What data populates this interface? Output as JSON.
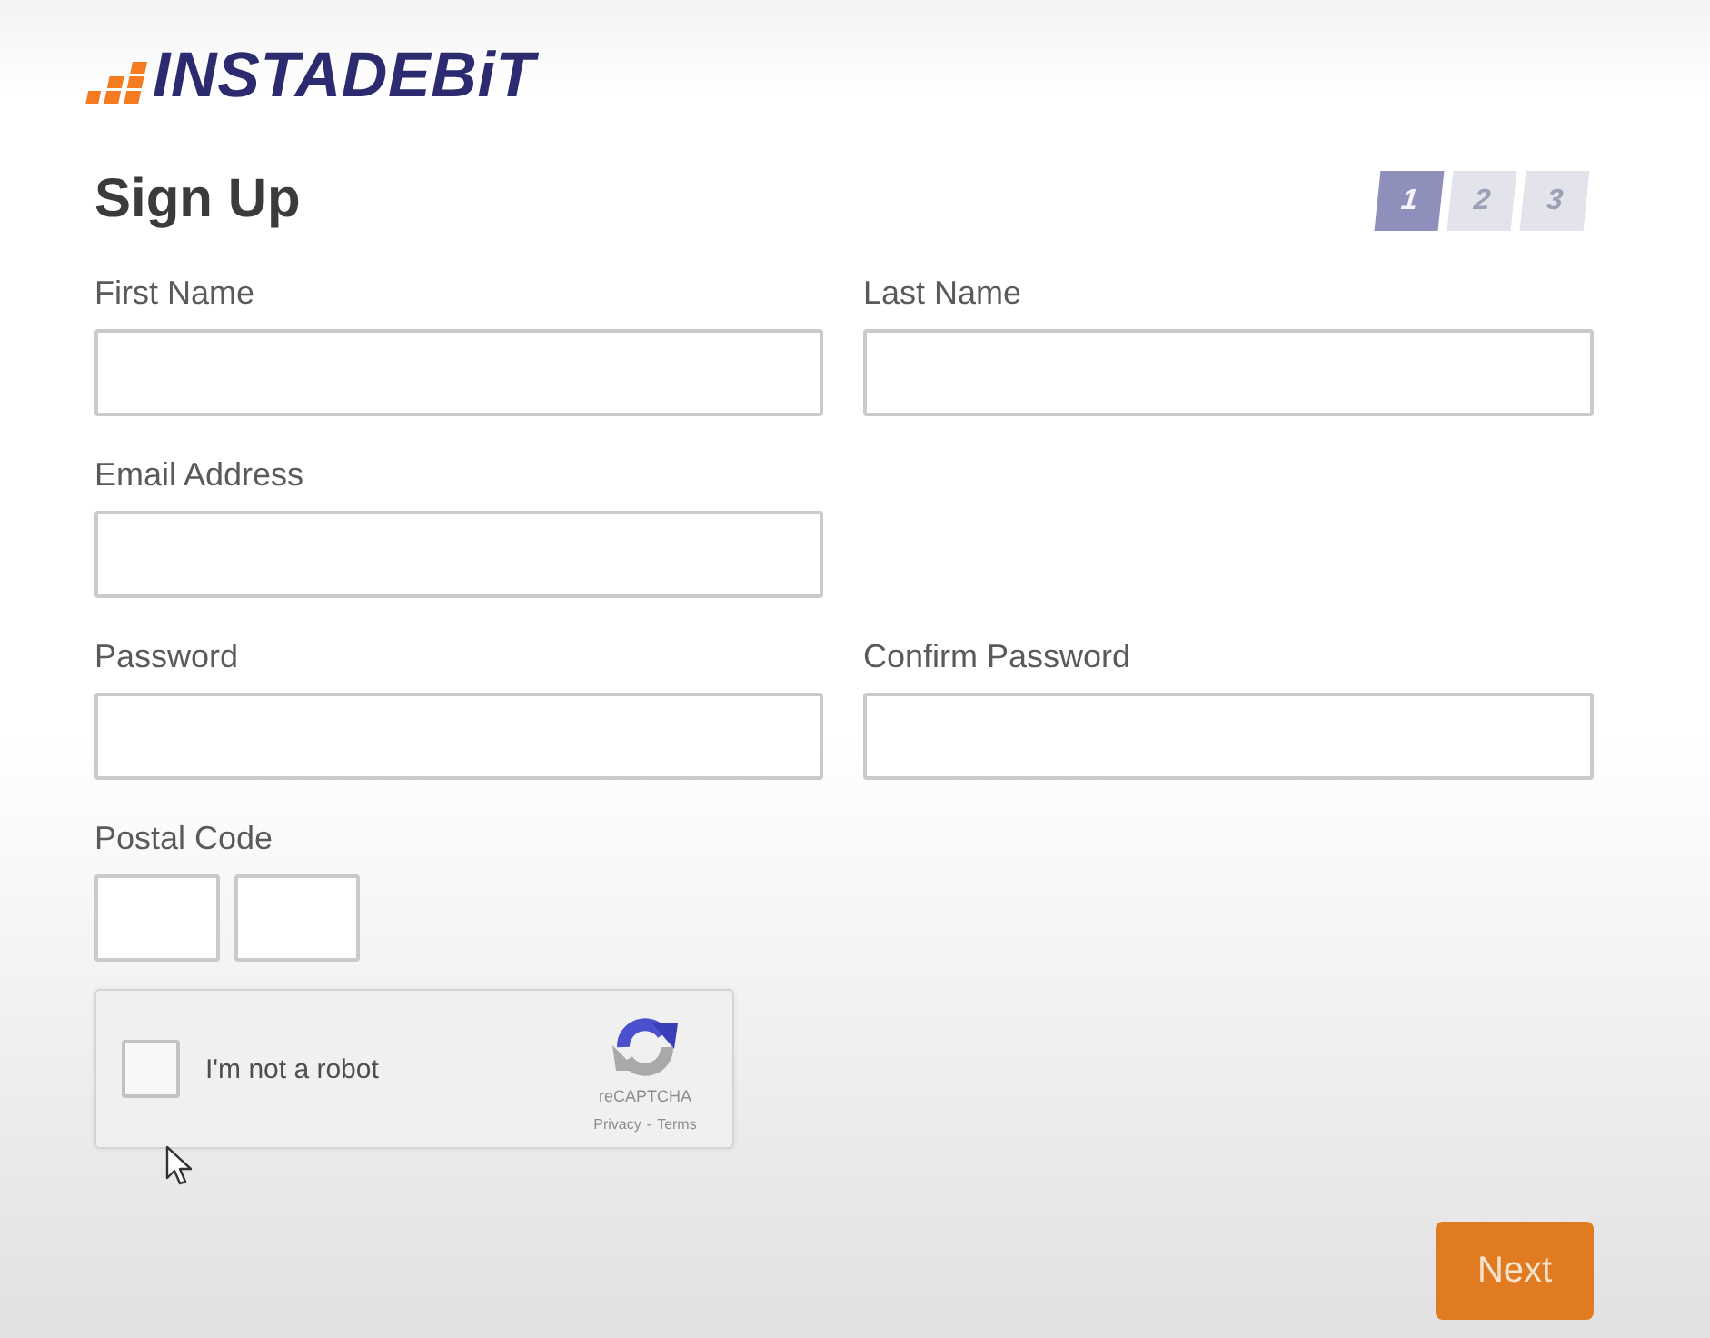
{
  "logo": {
    "text": "INSTADEBiT"
  },
  "heading": "Sign Up",
  "steps": [
    {
      "label": "1",
      "selected": true
    },
    {
      "label": "2",
      "selected": false
    },
    {
      "label": "3",
      "selected": false
    }
  ],
  "form": {
    "rows": [
      {
        "fields": [
          {
            "label": "First Name",
            "kind": "text"
          },
          {
            "label": "Last Name",
            "kind": "text"
          }
        ]
      },
      {
        "fields": [
          {
            "label": "Email Address",
            "kind": "text"
          }
        ]
      },
      {
        "fields": [
          {
            "label": "Password",
            "kind": "text"
          },
          {
            "label": "Confirm Password",
            "kind": "text"
          }
        ]
      },
      {
        "fields": [
          {
            "label": "Postal Code",
            "kind": "postal_code"
          }
        ]
      }
    ]
  },
  "captcha": {
    "checked": false,
    "label": "I'm not a robot",
    "brand": "reCAPTCHA",
    "links": [
      "Privacy",
      "Terms"
    ],
    "separator": "-"
  },
  "buttons": [
    {
      "label": "Next"
    }
  ]
}
